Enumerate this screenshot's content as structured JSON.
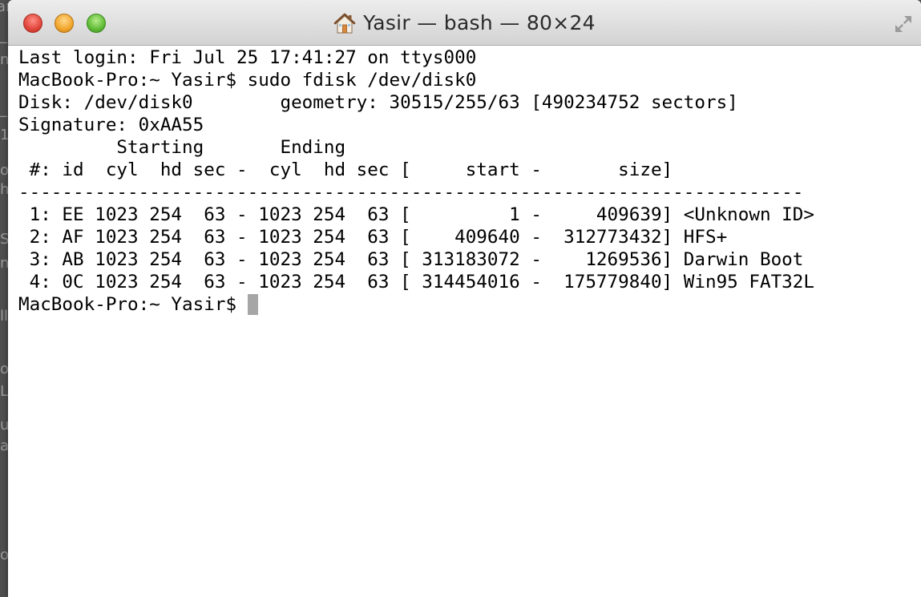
{
  "window": {
    "title": "Yasir — bash — 80×24",
    "title_icon": "home-icon"
  },
  "background": {
    "fragments": [
      "artition",
      "_",
      "n",
      "_",
      "1",
      "o",
      "h",
      "S",
      "n",
      "ll",
      "o",
      "Li",
      "ua",
      "a",
      "or"
    ]
  },
  "terminal": {
    "lines": [
      "Last login: Fri Jul 25 17:41:27 on ttys000",
      "MacBook-Pro:~ Yasir$ sudo fdisk /dev/disk0",
      "Disk: /dev/disk0        geometry: 30515/255/63 [490234752 sectors]",
      "Signature: 0xAA55",
      "         Starting       Ending",
      " #: id  cyl  hd sec -  cyl  hd sec [     start -       size]",
      "------------------------------------------------------------------------",
      " 1: EE 1023 254  63 - 1023 254  63 [         1 -     409639] <Unknown ID>",
      " 2: AF 1023 254  63 - 1023 254  63 [    409640 -  312773432] HFS+",
      " 3: AB 1023 254  63 - 1023 254  63 [ 313183072 -    1269536] Darwin Boot",
      " 4: 0C 1023 254  63 - 1023 254  63 [ 314454016 -  175779840] Win95 FAT32L"
    ],
    "prompt": "MacBook-Pro:~ Yasir$ "
  },
  "colors": {
    "terminal_bg": "#ffffff",
    "terminal_text": "#000000",
    "cursor": "#a6a6a6",
    "close_button": "#e0453a",
    "minimize_button": "#f1a52b",
    "zoom_button": "#5fbb36"
  }
}
